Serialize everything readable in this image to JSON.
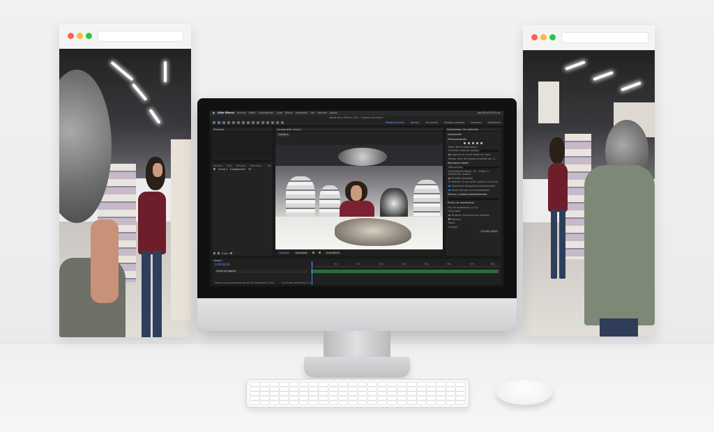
{
  "colors": {
    "traffic_red": "#ff5f57",
    "traffic_yellow": "#febc2e",
    "traffic_green": "#28c840",
    "ae_accent": "#2f7fe6",
    "timecode_blue": "#4f9bff"
  },
  "after_effects": {
    "menubar": {
      "app": "After Effects",
      "menus": [
        "Archivo",
        "Editar",
        "Composición",
        "Capa",
        "Efecto",
        "Animación",
        "Ver",
        "Ventana",
        "Ayuda"
      ],
      "clock": "Jue 30 Jul 9:57 p.m."
    },
    "window_title": "Adobe After Effects 2024 - Proyecto sin título *",
    "workspaces": [
      "Predeterminado",
      "Revisar",
      "Formación",
      "Pantalla pequeña",
      "Estándar",
      "Bibliotecas"
    ],
    "project_panel": {
      "title": "Proyecto",
      "columns": [
        "Nombre",
        "Tipo",
        "Tamaño",
        "Velocidad...",
        "Ubi"
      ],
      "items": [
        {
          "name": "Comp 1",
          "type": "Composición",
          "rate": "25"
        }
      ],
      "footer_bpc": "8 bpc"
    },
    "comp_panel": {
      "title": "Composición Comp 1",
      "tab": "Comp 1",
      "footer_zoom": "Oct (%)",
      "footer_quality": "Completa",
      "footer_time": "0;00;00;00"
    },
    "properties_panel": {
      "title": "Propiedades: Sin selección",
      "sections": [
        {
          "head": "Información",
          "lines": []
        },
        {
          "head": "Previsualización",
          "lines": [
            "Atajo: Barra espaciadora",
            "Intervalo: Área de trabajo",
            "Alternar en caché antes de repro.",
            "Rango: Área de trabajo ampliada por vi..."
          ]
        },
        {
          "head": "Reproducir desde",
          "lines": [
            "Hora actual",
            "Velocidad de fotogr.: 25 · Saltar: 0 · Resolución: Autom.",
            "Pantalla completa",
            "Al detener: Si se caché, mostrar en caché",
            "Reproducir fotogramas almacenados",
            "Mover tiempo a previsualización"
          ]
        },
        {
          "head": "Efectos y ajustes preestablecidos",
          "lines": []
        },
        {
          "head": "Enlace de movimiento",
          "lines": [
            "Par de segmentos: 0.0 fp",
            "Suavizado",
            "Muestra: Estructura de modelos",
            "Tamaño",
            "Reina",
            "Ocasión"
          ]
        }
      ],
      "button": "Ocultar panel"
    },
    "timeline": {
      "tab": "Comp 1",
      "timecode": "0;00;00;00",
      "layer": "Fondo de página",
      "ticks": [
        "0s",
        "01s",
        "02s",
        "03s",
        "04s",
        "05s",
        "06s",
        "07s",
        "08s"
      ],
      "footer": "Tiempo de procesamiento de los fotogramas: 0ms",
      "footer_right": "Conmutar definitivos / m..."
    }
  }
}
